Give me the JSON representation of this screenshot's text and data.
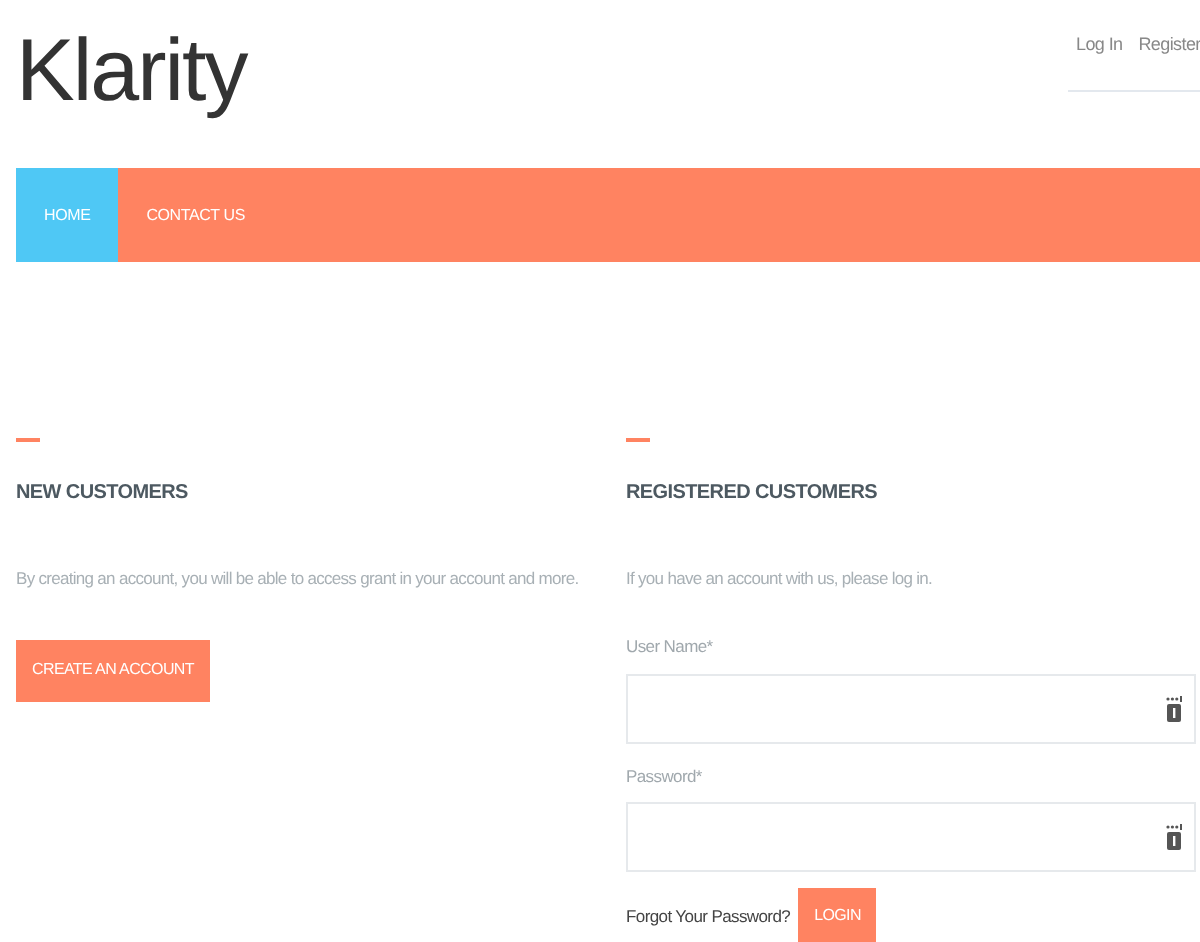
{
  "logo": "Klarity",
  "header_links": [
    "Log In",
    "Register"
  ],
  "nav": [
    {
      "label": "HOME",
      "selected": true
    },
    {
      "label": "CONTACT US",
      "selected": false
    }
  ],
  "new_customers": {
    "heading": "NEW CUSTOMERS",
    "text": "By creating an account, you will be able to access grant in your account and more.",
    "button": "CREATE AN ACCOUNT"
  },
  "registered_customers": {
    "heading": "REGISTERED CUSTOMERS",
    "text": "If you have an account with us, please log in.",
    "fields": [
      {
        "label": "User Name*"
      },
      {
        "label": "Password*"
      }
    ],
    "forgot_link": "Forgot Your Password?",
    "button": "LOGIN"
  }
}
